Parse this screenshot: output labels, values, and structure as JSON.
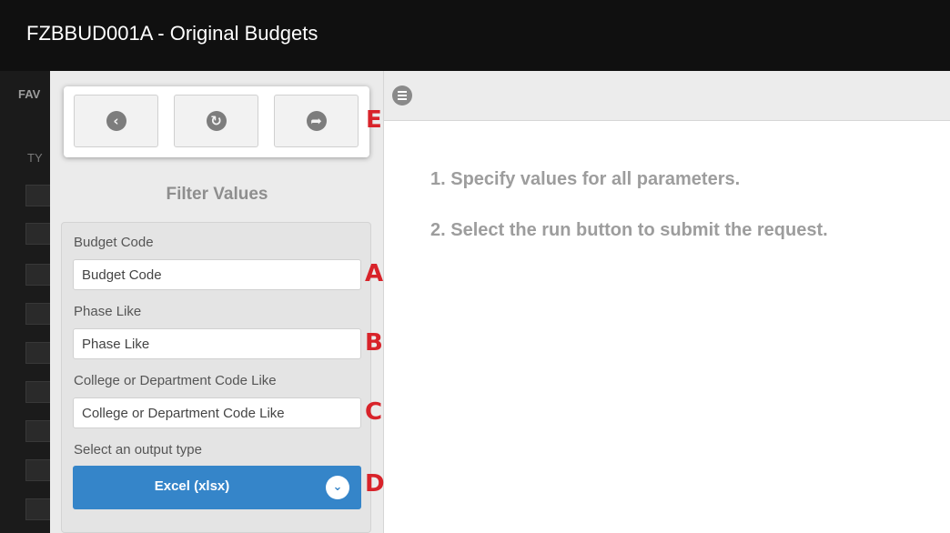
{
  "window": {
    "title": "FZBBUD001A - Original Budgets"
  },
  "left_strip": {
    "fav_label": "FAV",
    "ty_label": "TY"
  },
  "toolbar": {
    "back_icon": "chevron-left-icon",
    "refresh_icon": "refresh-icon",
    "share_icon": "share-icon"
  },
  "filter": {
    "title": "Filter Values",
    "budget_code": {
      "label": "Budget Code",
      "placeholder": "Budget Code"
    },
    "phase_like": {
      "label": "Phase Like",
      "placeholder": "Phase Like"
    },
    "college_dept": {
      "label": "College or Department Code Like",
      "placeholder": "College or Department Code Like"
    },
    "output": {
      "label": "Select an output type",
      "value": "Excel (xlsx)"
    }
  },
  "markers": {
    "a": "A",
    "b": "B",
    "c": "C",
    "d": "D",
    "e": "E"
  },
  "instructions": {
    "step1": "1. Specify values for all parameters.",
    "step2": "2. Select the run button to submit the request."
  },
  "colors": {
    "accent": "#3585c9",
    "marker": "#d8232a",
    "title_bar": "#101010"
  }
}
